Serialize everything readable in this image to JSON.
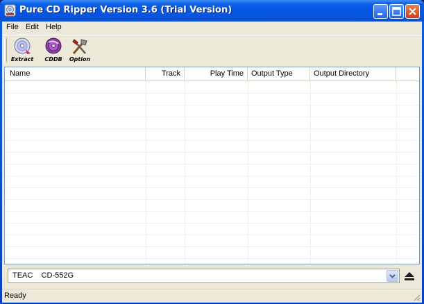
{
  "window": {
    "title": "Pure CD Ripper Version 3.6 (Trial Version)"
  },
  "menu": [
    "File",
    "Edit",
    "Help"
  ],
  "toolbar": [
    {
      "label": "Extract",
      "icon": "extract-cd-icon"
    },
    {
      "label": "CDDB",
      "icon": "cddb-icon"
    },
    {
      "label": "Option",
      "icon": "option-tools-icon"
    }
  ],
  "columns": [
    "Name",
    "Track",
    "Play Time",
    "Output Type",
    "Output Directory"
  ],
  "drive": {
    "selected": "TEAC    CD-552G"
  },
  "status": {
    "text": "Ready"
  }
}
